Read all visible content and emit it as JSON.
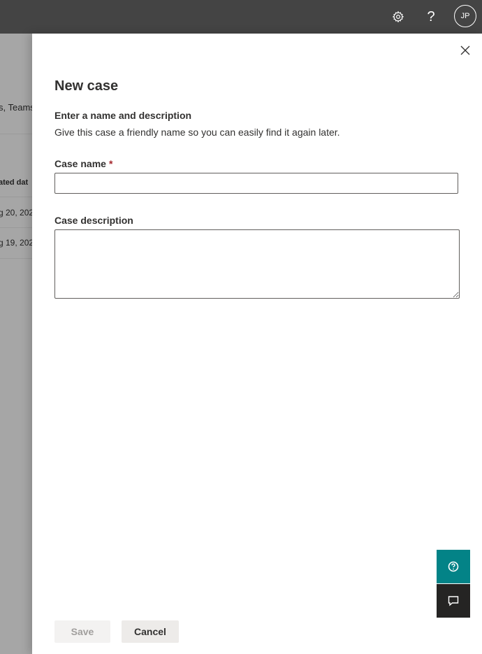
{
  "topbar": {
    "settings_icon": "gear-icon",
    "help_icon": "question-icon",
    "help_glyph": "?",
    "avatar_initials": "JP"
  },
  "background_page": {
    "fragment_teams": "s, Teams",
    "column_header": "ated dat",
    "row_1_date": "g 20, 202",
    "row_2_date": "g 19, 202"
  },
  "panel": {
    "close_icon": "close-icon",
    "title": "New case",
    "section_heading": "Enter a name and description",
    "section_description": "Give this case a friendly name so you can easily find it again later.",
    "case_name_label": "Case name",
    "required_marker": "*",
    "case_name_value": "",
    "case_description_label": "Case description",
    "case_description_value": "",
    "save_label": "Save",
    "cancel_label": "Cancel"
  },
  "floating": {
    "help_icon": "help-circle-icon",
    "feedback_icon": "feedback-icon"
  },
  "colors": {
    "topbar": "#444444",
    "overlay": "#a6a6a6",
    "required": "#a4262c",
    "help_fab": "#038387",
    "feedback_fab": "#252423"
  }
}
